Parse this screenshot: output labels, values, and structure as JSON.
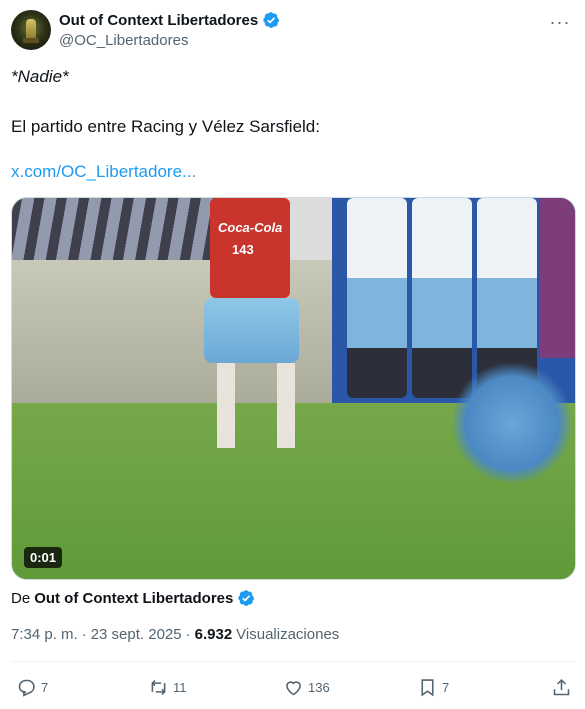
{
  "author": {
    "display_name": "Out of Context Libertadores",
    "handle": "@OC_Libertadores",
    "verified": true
  },
  "tweet": {
    "line1": "*Nadie*",
    "line2": "El partido entre Racing y Vélez Sarsfield:",
    "link": "x.com/OC_Libertadore..."
  },
  "media": {
    "duration": "0:01",
    "jersey_sponsor": "Coca-Cola",
    "jersey_number": "143"
  },
  "source": {
    "prefix": "De",
    "name": "Out of Context Libertadores"
  },
  "meta": {
    "time": "7:34 p. m.",
    "separator": "·",
    "date": "23 sept. 2025",
    "separator2": "·",
    "views_count": "6.932",
    "views_label": "Visualizaciones"
  },
  "actions": {
    "replies": "7",
    "retweets": "11",
    "likes": "136",
    "bookmarks": "7"
  },
  "colors": {
    "accent": "#1d9bf0",
    "secondary_text": "#536471",
    "verified": "#1d9bf0"
  }
}
